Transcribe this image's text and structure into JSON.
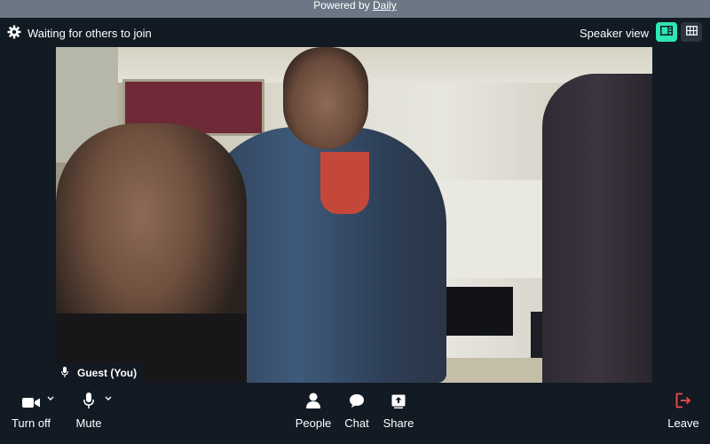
{
  "banner": {
    "prefix": "Powered by",
    "brand": "Daily"
  },
  "topbar": {
    "status_text": "Waiting for others to join",
    "view_label": "Speaker view",
    "settings_icon": "gear-icon",
    "speaker_view_icon": "speaker-view-icon",
    "grid_view_icon": "grid-view-icon",
    "accent_color": "#2ee6b2"
  },
  "video": {
    "participant_name": "Guest (You)",
    "participant_mic_icon": "microphone-icon"
  },
  "controls": {
    "camera": {
      "label": "Turn off",
      "icon": "video-camera-icon"
    },
    "mic": {
      "label": "Mute",
      "icon": "microphone-icon"
    },
    "people": {
      "label": "People",
      "icon": "person-icon"
    },
    "chat": {
      "label": "Chat",
      "icon": "chat-bubble-icon"
    },
    "share": {
      "label": "Share",
      "icon": "share-screen-icon"
    },
    "leave": {
      "label": "Leave",
      "icon": "leave-icon",
      "color": "#f04b4b"
    }
  }
}
